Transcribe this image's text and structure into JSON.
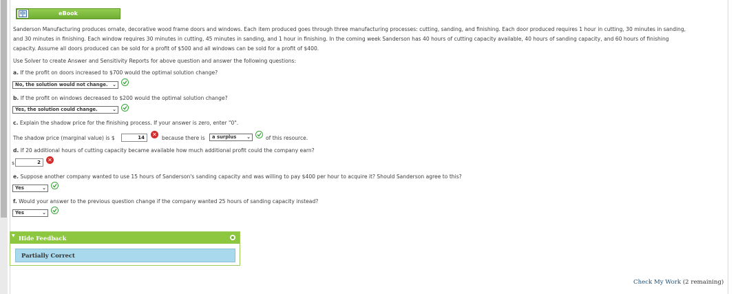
{
  "ebook": {
    "label": "eBook"
  },
  "problem": {
    "line1": "Sanderson Manufacturing produces ornate, decorative wood frame doors and windows. Each item produced goes through three manufacturing processes: cutting, sanding, and finishing. Each door produced requires 1 hour in cutting, 30 minutes in sanding,",
    "line2": "and 30 minutes in finishing. Each window requires 30 minutes in cutting, 45 minutes in sanding, and 1 hour in finishing. In the coming week Sanderson has 40 hours of cutting capacity available, 40 hours of sanding capacity, and 60 hours of finishing",
    "line3": "capacity. Assume all doors produced can be sold for a profit of $500 and all windows can be sold for a profit of $400.",
    "instruction": "Use Solver to create Answer and Sensitivity Reports for above question and answer the following questions:"
  },
  "questions": {
    "a": {
      "label": "a.",
      "text": "If the profit on doors increased to $700 would the optimal solution change?",
      "answer": "No, the solution would not change."
    },
    "b": {
      "label": "b.",
      "text": "If the profit on windows decreased to $200 would the optimal solution change?",
      "answer": "Yes, the solution could change."
    },
    "c": {
      "label": "c.",
      "text": "Explain the shadow price for the finishing process. If your answer is zero, enter \"0\".",
      "prefix": "The shadow price (marginal value) is $",
      "value": "14",
      "middle": "because there is",
      "select": "a surplus",
      "suffix": "of this resource."
    },
    "d": {
      "label": "d.",
      "text": "If 20 additional hours of cutting capacity became available how much additional profit could the company earn?",
      "currency": "$",
      "value": "2"
    },
    "e": {
      "label": "e.",
      "text": "Suppose another company wanted to use 15 hours of Sanderson's sanding capacity and was willing to pay $400 per hour to acquire it? Should Sanderson agree to this?",
      "answer": "Yes"
    },
    "f": {
      "label": "f.",
      "text": "Would your answer to the previous question change if the company wanted 25 hours of sanding capacity instead?",
      "answer": "Yes"
    }
  },
  "feedback": {
    "title": "Hide Feedback",
    "status": "Partially Correct"
  },
  "footer": {
    "check_label": "Check My Work",
    "remaining": "(2 remaining)"
  }
}
